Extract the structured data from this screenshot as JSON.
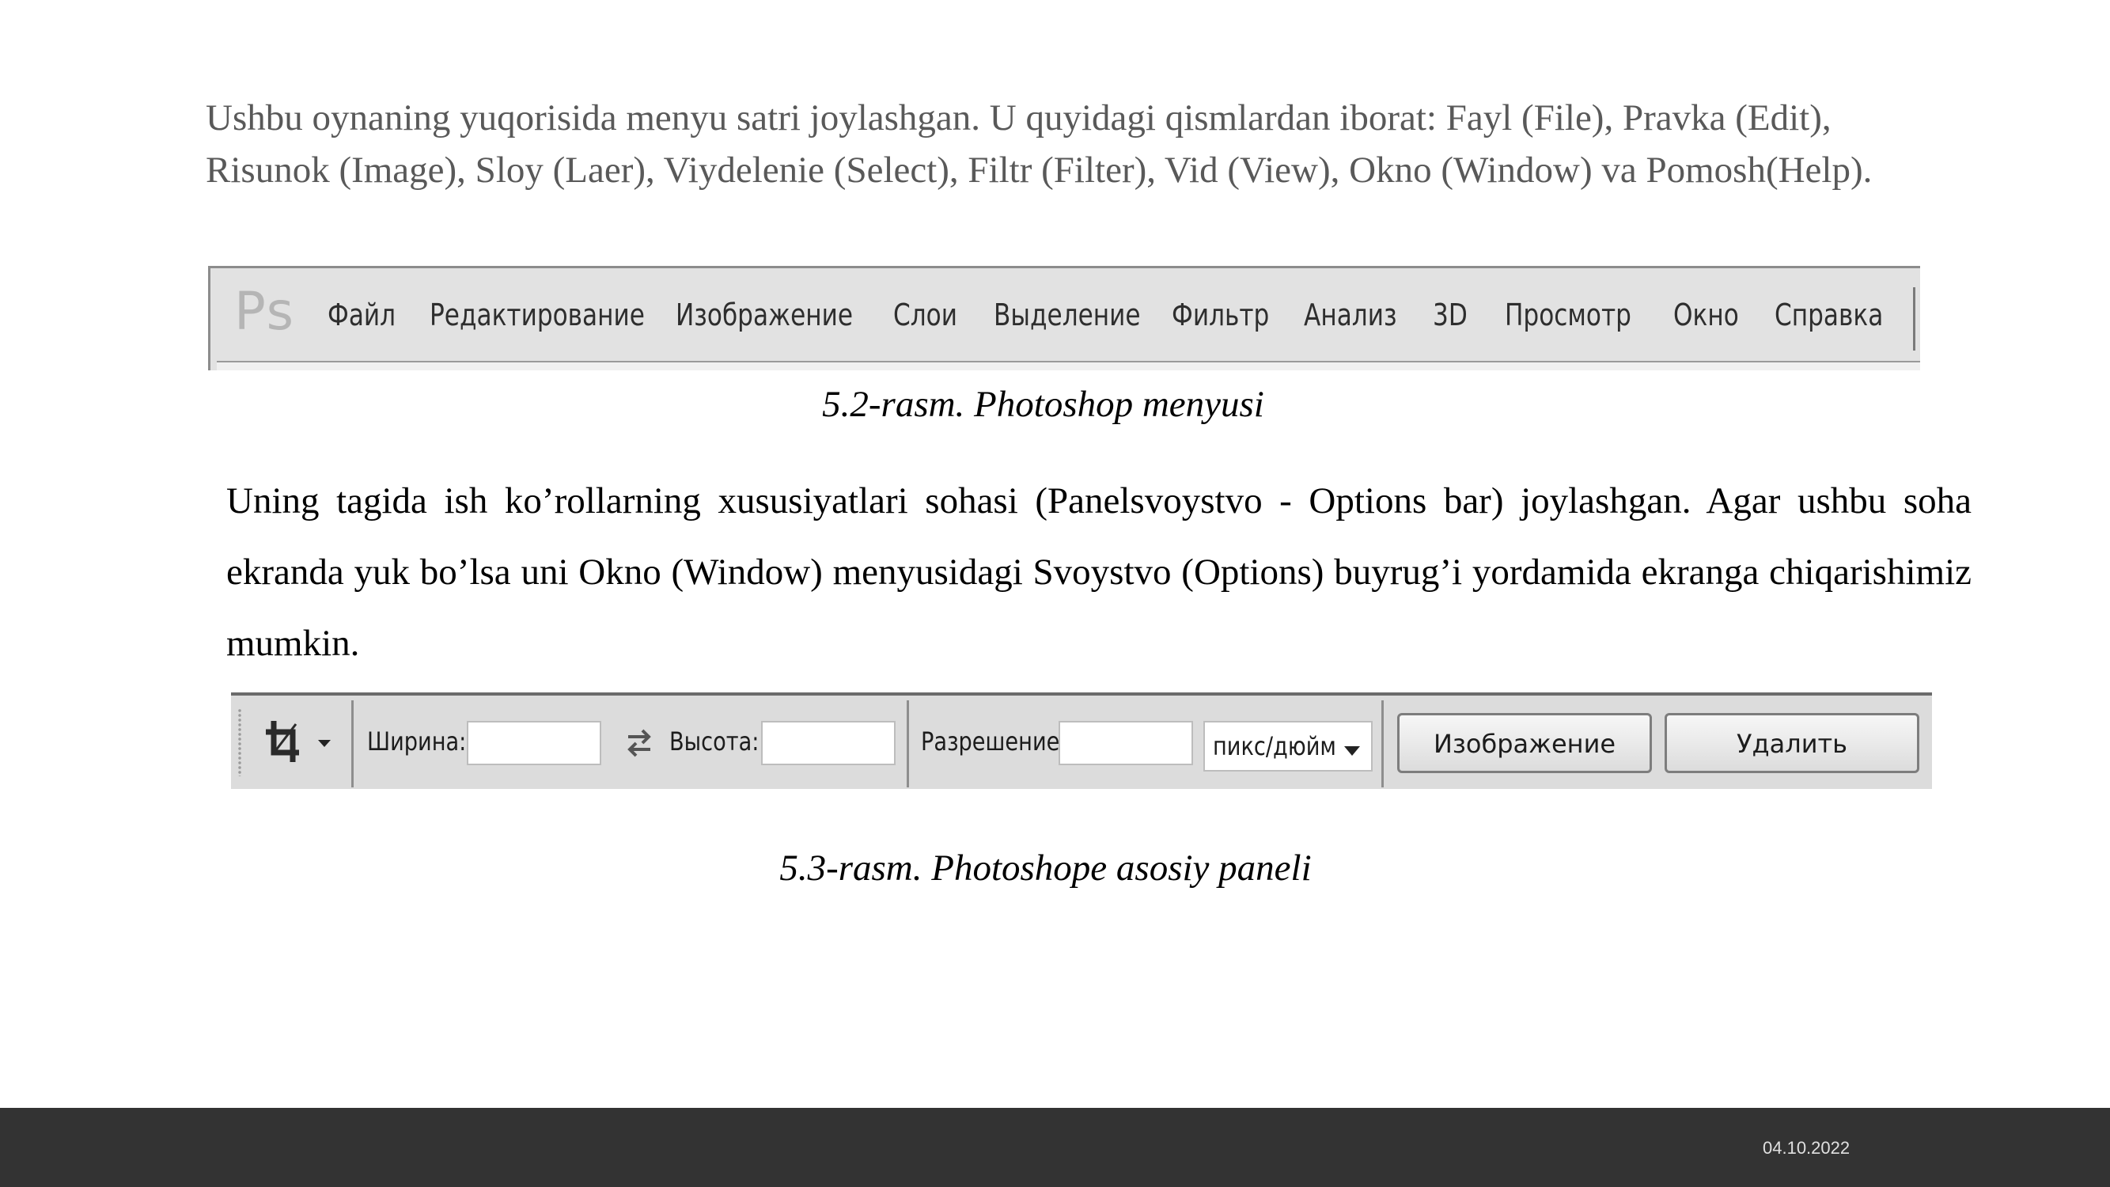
{
  "paragraph1": "Ushbu oynaning yuqorisida menyu satri joylashgan. U quyidagi qismlardan iborat: Fayl (File), Pravka (Edit), Risunok (Image), Sloy (Laer), Viydelenie (Select), Filtr (Filter), Vid (View), Okno (Window) va Pomosh(Help).",
  "menubar": {
    "logo": "Ps",
    "items": [
      "Файл",
      "Редактирование",
      "Изображение",
      "Слои",
      "Выделение",
      "Фильтр",
      "Анализ",
      "3D",
      "Просмотр",
      "Окно",
      "Справка"
    ]
  },
  "caption1": "5.2-rasm. Photoshop menyusi",
  "paragraph2": "Uning tagida ish ko’rollarning xususiyatlari sohasi (Panelsvoystvo - Options bar) joylashgan. Agar ushbu soha ekranda yuk bo’lsa uni Okno (Window) menyusidagi Svoystvo (Options) buyrug’i yordamida ekranga chiqarishimiz mumkin.",
  "optionsbar": {
    "width_label": "Ширина:",
    "height_label": "Высота:",
    "resolution_label": "Разрешение:",
    "unit_select": "пикс/дюйм",
    "image_button": "Изображение",
    "delete_button": "Удалить"
  },
  "caption2": "5.3-rasm. Photoshope asosiy paneli",
  "footer": {
    "date": "04.10.2022"
  }
}
